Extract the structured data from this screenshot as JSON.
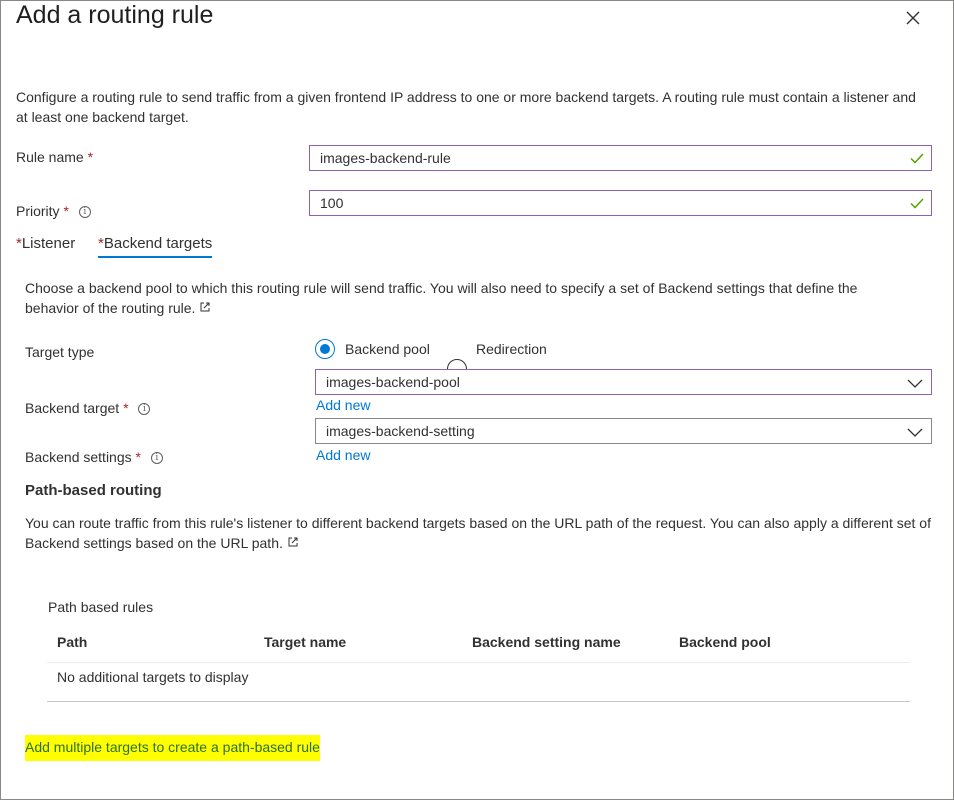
{
  "panel": {
    "title": "Add a routing rule",
    "description": "Configure a routing rule to send traffic from a given frontend IP address to one or more backend targets. A routing rule must contain a listener and at least one backend target."
  },
  "rule_name": {
    "label": "Rule name",
    "value": "images-backend-rule"
  },
  "priority": {
    "label": "Priority",
    "value": "100"
  },
  "tabs": [
    {
      "label": "Listener",
      "required": "*"
    },
    {
      "label": "Backend targets",
      "required": "*"
    }
  ],
  "backend": {
    "description": "Choose a backend pool to which this routing rule will send traffic. You will also need to specify a set of Backend settings that define the behavior of the routing rule.",
    "target_type": {
      "label": "Target type",
      "options": [
        "Backend pool",
        "Redirection"
      ],
      "selected": "Backend pool"
    },
    "backend_target": {
      "label": "Backend target",
      "value": "images-backend-pool",
      "add_new": "Add new"
    },
    "backend_settings": {
      "label": "Backend settings",
      "value": "images-backend-setting",
      "add_new": "Add new"
    }
  },
  "path_routing": {
    "title": "Path-based routing",
    "description": "You can route traffic from this rule's listener to different backend targets based on the URL path of the request. You can also apply a different set of Backend settings based on the URL path.",
    "table_title": "Path based rules",
    "columns": [
      "Path",
      "Target name",
      "Backend setting name",
      "Backend pool"
    ],
    "empty_message": "No additional targets to display",
    "add_link": "Add multiple targets to create a path-based rule"
  },
  "required_mark": "*",
  "info_glyph": "i",
  "colors": {
    "accent": "#0078d4",
    "required": "#a4262c",
    "valid": "#57a300",
    "focus_border": "#8764b8",
    "highlight": "#ffff00"
  }
}
